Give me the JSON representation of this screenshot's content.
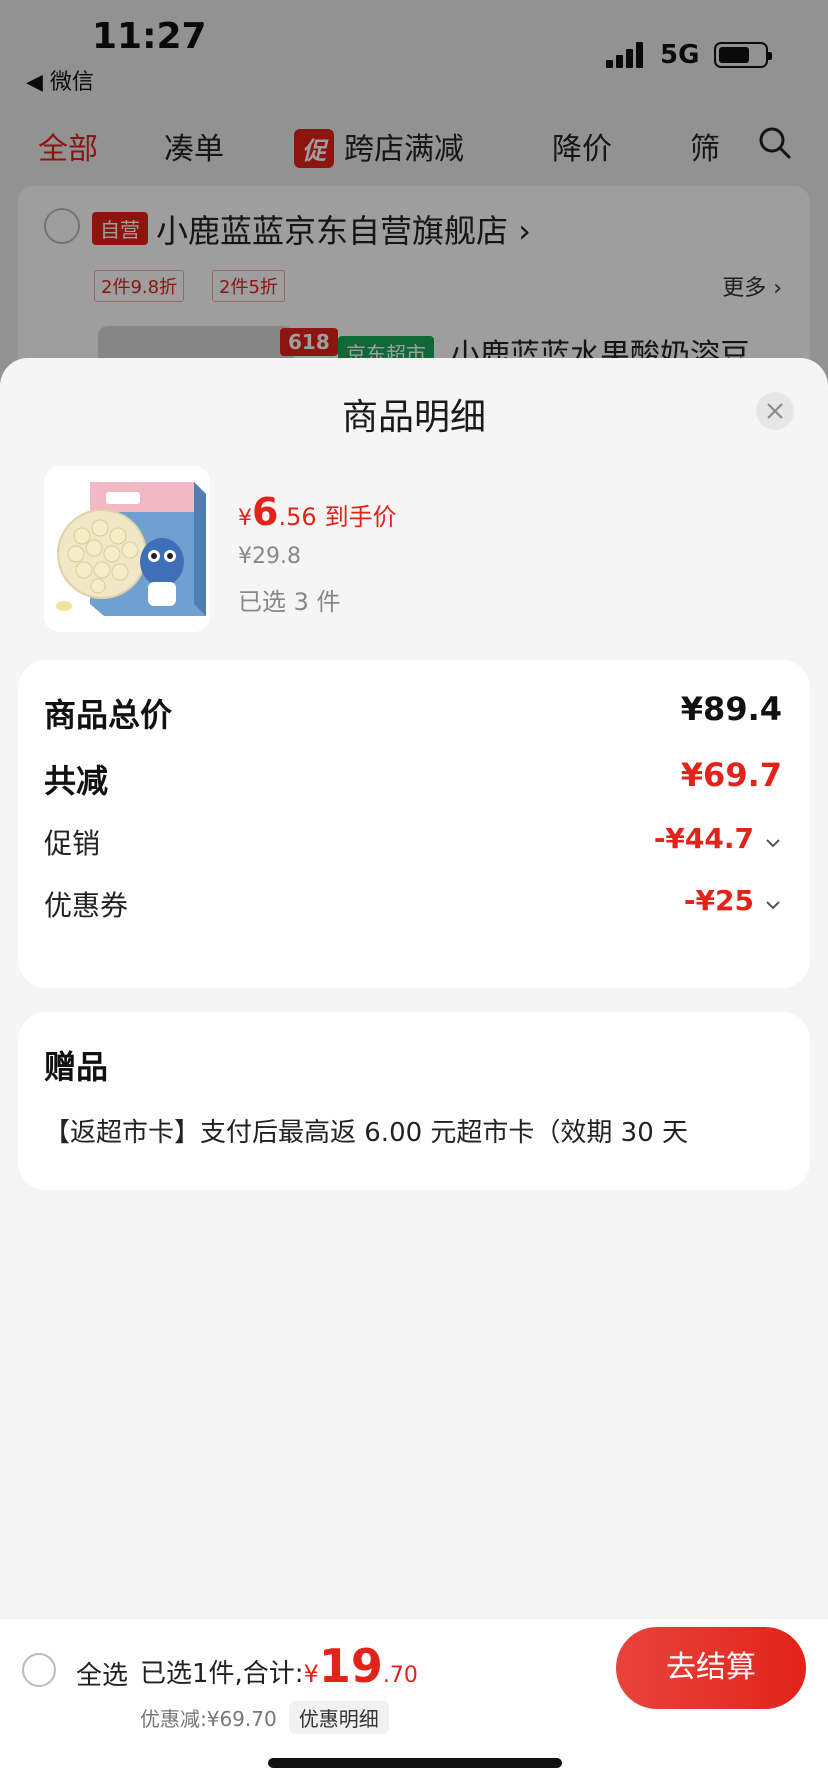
{
  "status_bar": {
    "time": "11:27",
    "back_app": "◀ 微信",
    "network": "5G"
  },
  "bg_tabs": {
    "all": "全部",
    "combine": "凑单",
    "promo_badge": "促",
    "cross_store": "跨店满减",
    "price_drop": "降价",
    "filter": "筛"
  },
  "bg_shop": {
    "self_badge": "自营",
    "name": "小鹿蓝蓝京东自营旗舰店 ›",
    "discount_tags": [
      "2件9.8折",
      "2件5折"
    ],
    "more": "更多 ›",
    "tag_618": "618",
    "jd_super": "京东超市",
    "product_title": "小鹿蓝蓝水果酸奶溶豆"
  },
  "sheet": {
    "title": "商品明细",
    "price_yen": "¥",
    "price_int": "6",
    "price_dec": ".56",
    "price_tag": "到手价",
    "original_price": "¥29.8",
    "selected": "已选 3 件"
  },
  "summary": {
    "total_label": "商品总价",
    "total_value": "¥89.4",
    "reduce_label": "共减",
    "reduce_value": "¥69.7",
    "promo_label": "促销",
    "promo_value": "-¥44.7",
    "coupon_label": "优惠券",
    "coupon_value": "-¥25"
  },
  "gift": {
    "title": "赠品",
    "text": "【返超市卡】支付后最高返 6.00 元超市卡（效期 30 天"
  },
  "bottom_bar": {
    "select_all": "全选",
    "selected_text": "已选1件,合计:",
    "total_yen": "¥",
    "total_int": "19",
    "total_dec": ".70",
    "discount_text": "优惠减:¥69.70",
    "detail_chip": "优惠明细",
    "checkout": "去结算"
  },
  "colors": {
    "accent": "#e2231a",
    "sheet_bg": "#f5f5f5",
    "card_bg": "#ffffff"
  }
}
